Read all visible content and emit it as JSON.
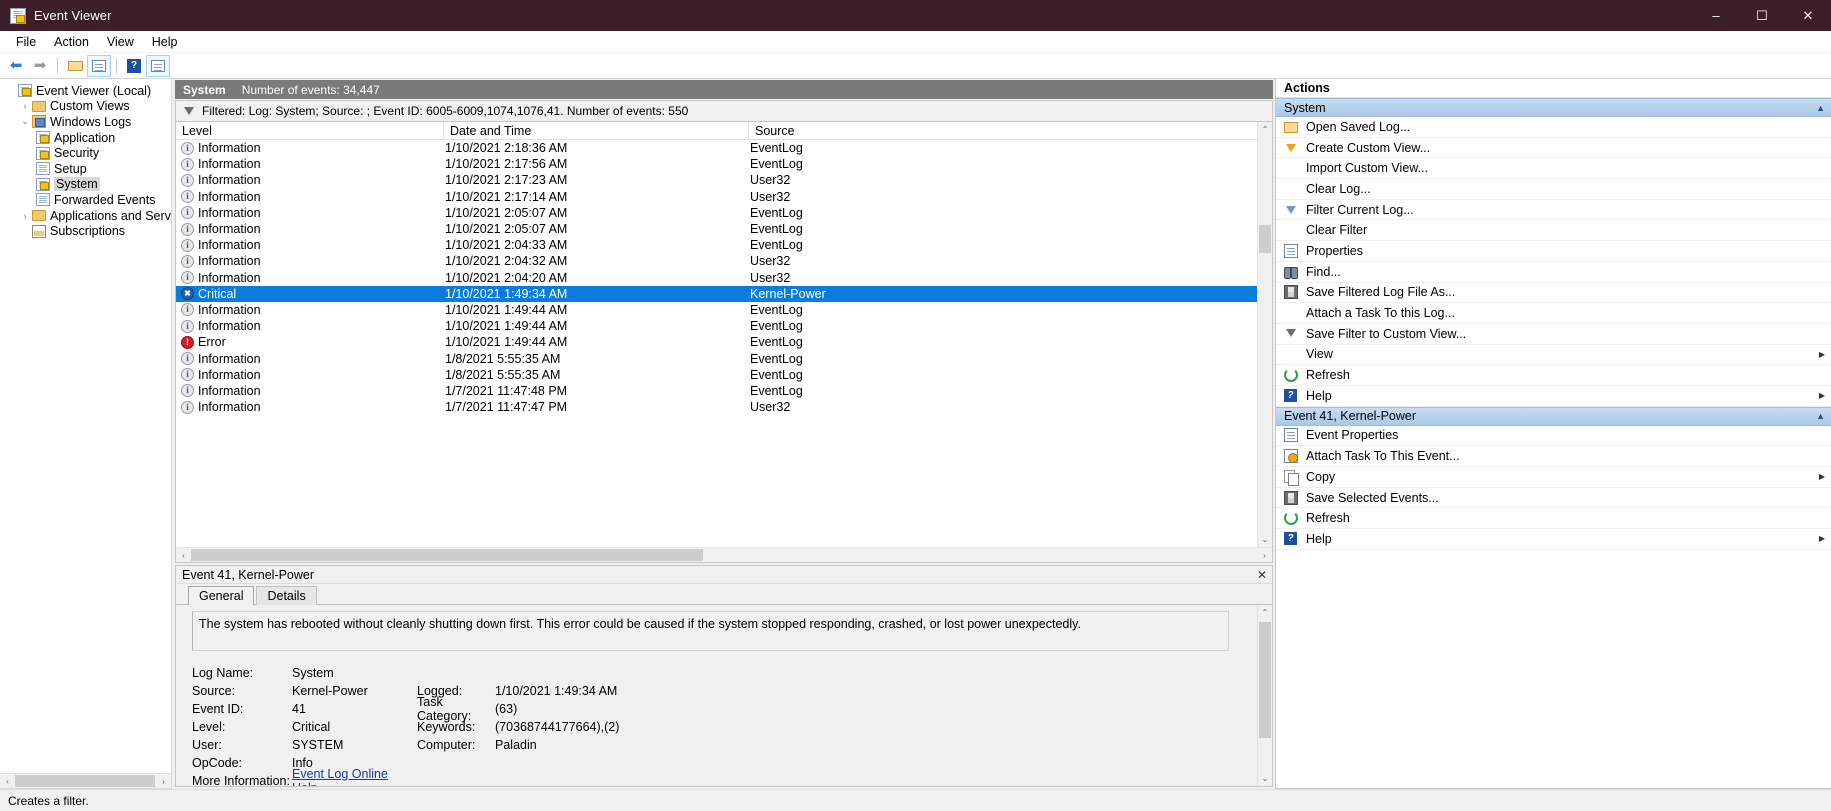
{
  "window": {
    "title": "Event Viewer",
    "icon": "event-viewer-icon",
    "minimize": "–",
    "maximize": "☐",
    "close": "✕"
  },
  "menubar": {
    "items": [
      {
        "label": "File"
      },
      {
        "label": "Action"
      },
      {
        "label": "View"
      },
      {
        "label": "Help"
      }
    ]
  },
  "toolbar": {
    "buttons": [
      {
        "name": "back-button",
        "glyph": "←"
      },
      {
        "name": "forward-button",
        "glyph": "→"
      },
      {
        "name": "open-folder-button",
        "glyph": ""
      },
      {
        "name": "show-hide-console-tree-button",
        "glyph": ""
      },
      {
        "name": "help-button",
        "glyph": "?"
      },
      {
        "name": "show-hide-action-pane-button",
        "glyph": ""
      }
    ]
  },
  "tree": {
    "nodes": [
      {
        "label": "Event Viewer (Local)",
        "indent": 0,
        "twisty": "",
        "icon": "event-viewer-icon",
        "selected": false
      },
      {
        "label": "Custom Views",
        "indent": 1,
        "twisty": "›",
        "icon": "folder-icon",
        "selected": false
      },
      {
        "label": "Windows Logs",
        "indent": 1,
        "twisty": "⌄",
        "icon": "windows-logs-icon",
        "selected": false
      },
      {
        "label": "Application",
        "indent": 2,
        "twisty": "",
        "icon": "log-warning-icon",
        "selected": false
      },
      {
        "label": "Security",
        "indent": 2,
        "twisty": "",
        "icon": "log-warning-icon",
        "selected": false
      },
      {
        "label": "Setup",
        "indent": 2,
        "twisty": "",
        "icon": "log-icon",
        "selected": false
      },
      {
        "label": "System",
        "indent": 2,
        "twisty": "",
        "icon": "log-warning-icon",
        "selected": true
      },
      {
        "label": "Forwarded Events",
        "indent": 2,
        "twisty": "",
        "icon": "log-icon",
        "selected": false
      },
      {
        "label": "Applications and Services Lo",
        "indent": 1,
        "twisty": "›",
        "icon": "folder-icon",
        "selected": false
      },
      {
        "label": "Subscriptions",
        "indent": 1,
        "twisty": "",
        "icon": "subscriptions-icon",
        "selected": false
      }
    ],
    "hscroll_left": "‹",
    "hscroll_right": "›"
  },
  "list_header": {
    "log_name": "System",
    "count_label": "Number of events: 34,447"
  },
  "filter_bar": {
    "text": "Filtered: Log: System; Source: ; Event ID: 6005-6009,1074,1076,41. Number of events: 550"
  },
  "grid": {
    "columns": [
      "Level",
      "Date and Time",
      "Source"
    ],
    "rows": [
      {
        "level": "Information",
        "icon": "information-icon",
        "date": "1/10/2021 2:18:36 AM",
        "source": "EventLog",
        "selected": false
      },
      {
        "level": "Information",
        "icon": "information-icon",
        "date": "1/10/2021 2:17:56 AM",
        "source": "EventLog",
        "selected": false
      },
      {
        "level": "Information",
        "icon": "information-icon",
        "date": "1/10/2021 2:17:23 AM",
        "source": "User32",
        "selected": false
      },
      {
        "level": "Information",
        "icon": "information-icon",
        "date": "1/10/2021 2:17:14 AM",
        "source": "User32",
        "selected": false
      },
      {
        "level": "Information",
        "icon": "information-icon",
        "date": "1/10/2021 2:05:07 AM",
        "source": "EventLog",
        "selected": false
      },
      {
        "level": "Information",
        "icon": "information-icon",
        "date": "1/10/2021 2:05:07 AM",
        "source": "EventLog",
        "selected": false
      },
      {
        "level": "Information",
        "icon": "information-icon",
        "date": "1/10/2021 2:04:33 AM",
        "source": "EventLog",
        "selected": false
      },
      {
        "level": "Information",
        "icon": "information-icon",
        "date": "1/10/2021 2:04:32 AM",
        "source": "User32",
        "selected": false
      },
      {
        "level": "Information",
        "icon": "information-icon",
        "date": "1/10/2021 2:04:20 AM",
        "source": "User32",
        "selected": false
      },
      {
        "level": "Critical",
        "icon": "critical-icon",
        "date": "1/10/2021 1:49:34 AM",
        "source": "Kernel-Power",
        "selected": true
      },
      {
        "level": "Information",
        "icon": "information-icon",
        "date": "1/10/2021 1:49:44 AM",
        "source": "EventLog",
        "selected": false
      },
      {
        "level": "Information",
        "icon": "information-icon",
        "date": "1/10/2021 1:49:44 AM",
        "source": "EventLog",
        "selected": false
      },
      {
        "level": "Error",
        "icon": "error-icon",
        "date": "1/10/2021 1:49:44 AM",
        "source": "EventLog",
        "selected": false
      },
      {
        "level": "Information",
        "icon": "information-icon",
        "date": "1/8/2021 5:55:35 AM",
        "source": "EventLog",
        "selected": false
      },
      {
        "level": "Information",
        "icon": "information-icon",
        "date": "1/8/2021 5:55:35 AM",
        "source": "EventLog",
        "selected": false
      },
      {
        "level": "Information",
        "icon": "information-icon",
        "date": "1/7/2021 11:47:48 PM",
        "source": "EventLog",
        "selected": false
      },
      {
        "level": "Information",
        "icon": "information-icon",
        "date": "1/7/2021 11:47:47 PM",
        "source": "User32",
        "selected": false
      }
    ],
    "scroll_up": "⌃",
    "scroll_down": "⌄",
    "scroll_left": "‹",
    "scroll_right": "›"
  },
  "detail": {
    "title": "Event 41, Kernel-Power",
    "close": "✕",
    "tabs": [
      {
        "label": "General",
        "active": true
      },
      {
        "label": "Details",
        "active": false
      }
    ],
    "message": "The system has rebooted without cleanly shutting down first. This error could be caused if the system stopped responding, crashed, or lost power unexpectedly.",
    "fields": [
      {
        "label": "Log Name:",
        "value": "System",
        "label2": "",
        "value2": ""
      },
      {
        "label": "Source:",
        "value": "Kernel-Power",
        "label2": "Logged:",
        "value2": "1/10/2021 1:49:34 AM"
      },
      {
        "label": "Event ID:",
        "value": "41",
        "label2": "Task Category:",
        "value2": "(63)"
      },
      {
        "label": "Level:",
        "value": "Critical",
        "label2": "Keywords:",
        "value2": "(70368744177664),(2)"
      },
      {
        "label": "User:",
        "value": "SYSTEM",
        "label2": "Computer:",
        "value2": "Paladin"
      },
      {
        "label": "OpCode:",
        "value": "Info",
        "label2": "",
        "value2": ""
      },
      {
        "label": "More Information:",
        "value": "Event Log Online Help",
        "label2": "",
        "value2": "",
        "link": true
      }
    ],
    "scroll_up": "⌃",
    "scroll_down": "⌄"
  },
  "actions": {
    "header": "Actions",
    "groups": [
      {
        "title": "System",
        "collapse_glyph": "▲",
        "items": [
          {
            "label": "Open Saved Log...",
            "icon": "open-folder-icon",
            "submenu": ""
          },
          {
            "label": "Create Custom View...",
            "icon": "filter-yellow-icon",
            "submenu": ""
          },
          {
            "label": "Import Custom View...",
            "icon": "",
            "submenu": ""
          },
          {
            "label": "Clear Log...",
            "icon": "",
            "submenu": ""
          },
          {
            "label": "Filter Current Log...",
            "icon": "filter-blue-icon",
            "submenu": ""
          },
          {
            "label": "Clear Filter",
            "icon": "",
            "submenu": ""
          },
          {
            "label": "Properties",
            "icon": "properties-icon",
            "submenu": ""
          },
          {
            "label": "Find...",
            "icon": "binoculars-icon",
            "submenu": ""
          },
          {
            "label": "Save Filtered Log File As...",
            "icon": "save-icon",
            "submenu": ""
          },
          {
            "label": "Attach a Task To this Log...",
            "icon": "",
            "submenu": ""
          },
          {
            "label": "Save Filter to Custom View...",
            "icon": "filter-save-icon",
            "submenu": ""
          },
          {
            "label": "View",
            "icon": "",
            "submenu": "▶"
          },
          {
            "label": "Refresh",
            "icon": "refresh-icon",
            "submenu": ""
          },
          {
            "label": "Help",
            "icon": "help-icon",
            "submenu": "▶"
          }
        ]
      },
      {
        "title": "Event 41, Kernel-Power",
        "collapse_glyph": "▲",
        "items": [
          {
            "label": "Event Properties",
            "icon": "properties-icon",
            "submenu": ""
          },
          {
            "label": "Attach Task To This Event...",
            "icon": "attach-task-icon",
            "submenu": ""
          },
          {
            "label": "Copy",
            "icon": "copy-icon",
            "submenu": "▶"
          },
          {
            "label": "Save Selected Events...",
            "icon": "save-icon",
            "submenu": ""
          },
          {
            "label": "Refresh",
            "icon": "refresh-icon",
            "submenu": ""
          },
          {
            "label": "Help",
            "icon": "help-icon",
            "submenu": "▶"
          }
        ]
      }
    ]
  },
  "statusbar": {
    "text": "Creates a filter."
  },
  "colors": {
    "titlebar_bg": "#3d1f29",
    "selection_blue": "#0a7ddc",
    "group_header_blue": "#a9c9e8",
    "list_header_gray": "#7a7a7a",
    "critical_icon": "#1c63b8",
    "error_icon": "#cf2027",
    "link": "#0b3fa0"
  }
}
